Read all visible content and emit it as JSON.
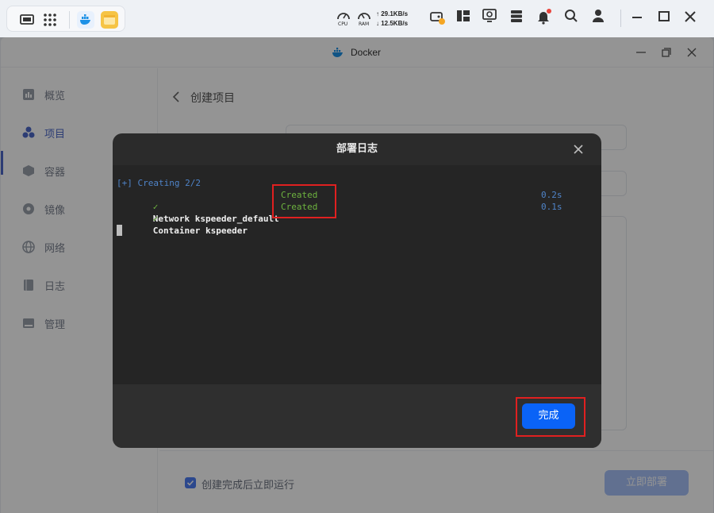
{
  "taskbar": {
    "cpu_label": "CPU",
    "ram_label": "RAM",
    "upload_speed": "29.1KB/s",
    "download_speed": "12.5KB/s"
  },
  "window": {
    "title": "Docker"
  },
  "sidebar": {
    "items": [
      {
        "label": "概览",
        "icon": "overview-icon"
      },
      {
        "label": "项目",
        "icon": "project-icon",
        "active": true
      },
      {
        "label": "容器",
        "icon": "container-icon"
      },
      {
        "label": "镜像",
        "icon": "image-icon"
      },
      {
        "label": "网络",
        "icon": "network-icon"
      },
      {
        "label": "日志",
        "icon": "log-icon"
      },
      {
        "label": "管理",
        "icon": "manage-icon"
      }
    ]
  },
  "main": {
    "header": "创建项目",
    "run_after_create_label": "创建完成后立即运行",
    "run_after_create_checked": true,
    "deploy_button": "立即部署"
  },
  "modal": {
    "title": "部署日志",
    "log": {
      "header": "[+] Creating 2/2",
      "rows": [
        {
          "check": "✓",
          "text": "Network kspeeder_default",
          "status": "Created",
          "time": "0.2s"
        },
        {
          "check": "✓",
          "text": "Container kspeeder",
          "status": "Created",
          "time": "0.1s"
        }
      ]
    },
    "done_button": "完成"
  },
  "colors": {
    "accent": "#0a63f7",
    "status_green": "#6db33f",
    "highlight_red": "#e02020"
  }
}
